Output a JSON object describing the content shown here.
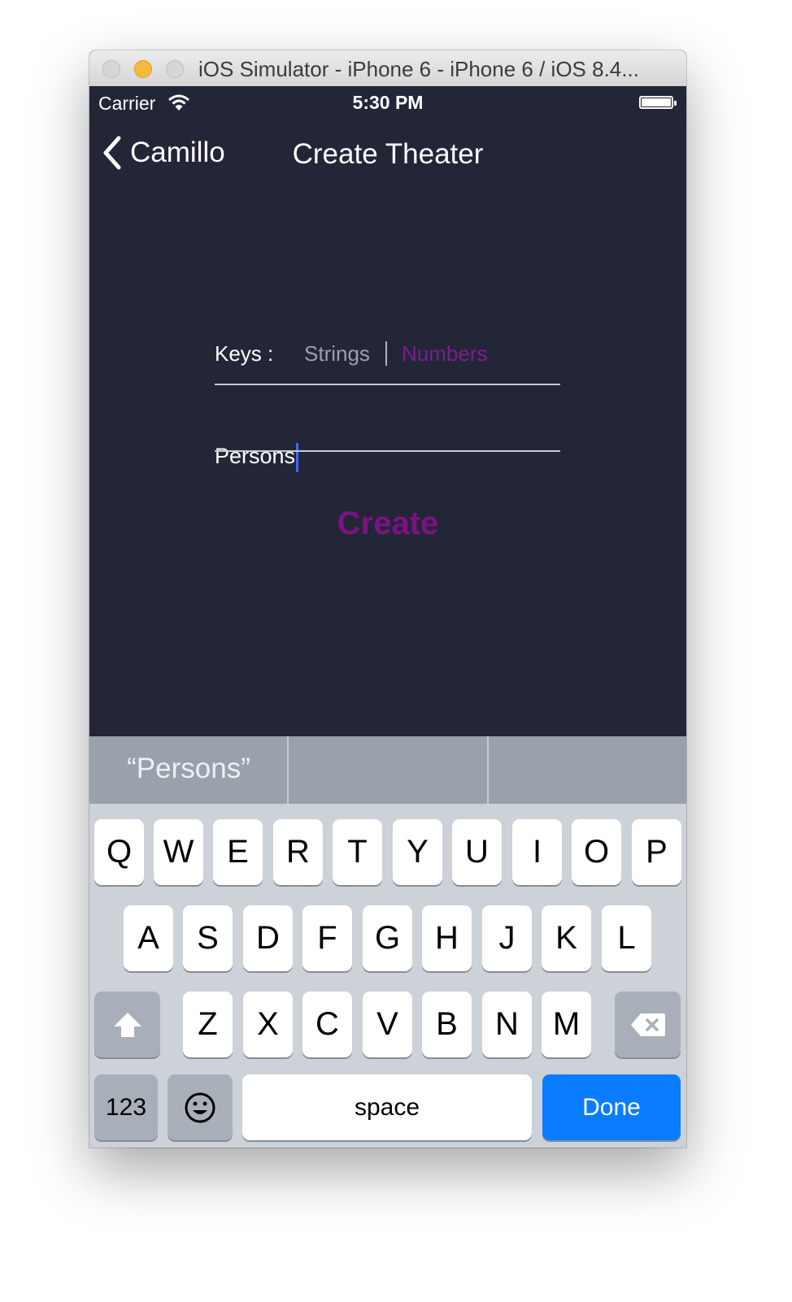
{
  "window": {
    "title": "iOS Simulator - iPhone 6 - iPhone 6 / iOS 8.4..."
  },
  "status_bar": {
    "carrier": "Carrier",
    "time": "5:30 PM"
  },
  "nav": {
    "back_label": "Camillo",
    "title": "Create Theater"
  },
  "form": {
    "keys_label": "Keys :",
    "segment_strings": "Strings",
    "segment_numbers": "Numbers",
    "selected_segment": "Numbers",
    "name_value": "Persons",
    "create_label": "Create"
  },
  "suggestions": [
    "“Persons”",
    "",
    ""
  ],
  "keyboard": {
    "row1": [
      "Q",
      "W",
      "E",
      "R",
      "T",
      "Y",
      "U",
      "I",
      "O",
      "P"
    ],
    "row2": [
      "A",
      "S",
      "D",
      "F",
      "G",
      "H",
      "J",
      "K",
      "L"
    ],
    "row3": [
      "Z",
      "X",
      "C",
      "V",
      "B",
      "N",
      "M"
    ],
    "numbers_label": "123",
    "space_label": "space",
    "return_label": "Done"
  },
  "colors": {
    "background": "#232637",
    "accent_purple": "#7d1185",
    "done_blue": "#0a7cff"
  }
}
